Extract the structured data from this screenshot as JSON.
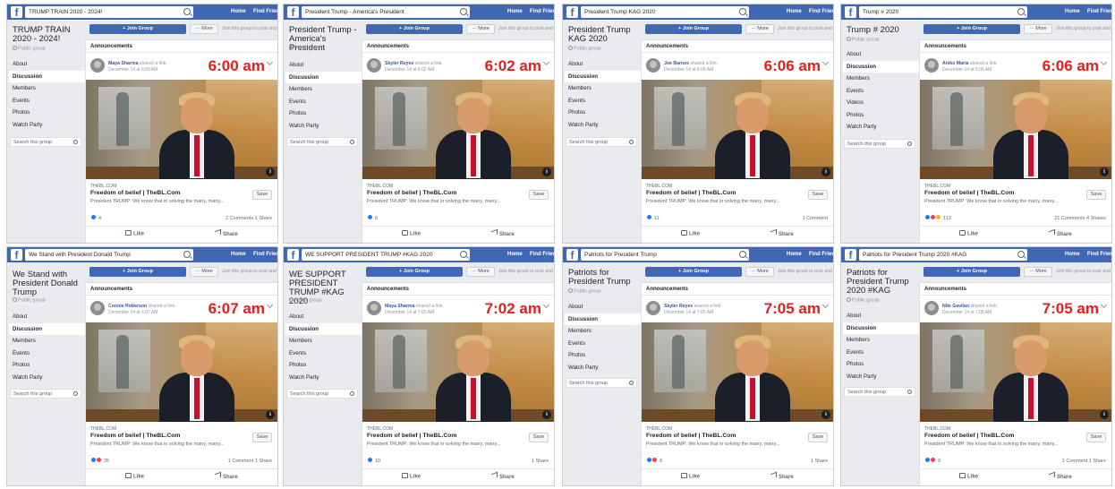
{
  "common": {
    "home": "Home",
    "find_friends": "Find Friends",
    "join_group": "+ Join Group",
    "more": "··· More",
    "join_hint": "Join this group to post and",
    "announcements": "Announcements",
    "public_group": "Public group",
    "shared_link": "shared a link.",
    "site": "THEBL.COM",
    "link_title": "Freedom of belief | TheBL.Com",
    "link_desc": "President TRUMP: We know that in solving the many, many...",
    "save": "Save",
    "like": "Like",
    "share": "Share",
    "search_group": "Search this group",
    "fb_letter": "f",
    "info_letter": "i",
    "menu_labels": {
      "about": "About",
      "discussion": "Discussion",
      "members": "Members",
      "events": "Events",
      "videos": "Videos",
      "photos": "Photos",
      "watch_party": "Watch Party"
    }
  },
  "colors": {
    "facebook_blue": "#4267b2",
    "time_red": "#e02020",
    "link_blue": "#385898"
  },
  "screenshots": [
    {
      "search_text": "TRUMP TRAIN 2020 - 2024!",
      "group_name": "TRUMP TRAIN 2020 - 2024!",
      "poster": "Maya Sharma",
      "date": "December 14 at 6:00 AM",
      "time": "6:00 am",
      "reaction_count": "4",
      "comments": "2 Comments  1 Share"
    },
    {
      "search_text": "President Trump - America's President",
      "group_name": "President Trump - America's President",
      "poster": "Skyler Reyes",
      "date": "December 14 at 6:02 AM",
      "time": "6:02 am",
      "reaction_count": "8",
      "comments": ""
    },
    {
      "search_text": "President Trump KAG 2020",
      "group_name": "President Trump KAG 2020",
      "poster": "Joe Barnes",
      "date": "December 14 at 6:06 AM",
      "time": "6:06 am",
      "reaction_count": "11",
      "comments": "1 Comment"
    },
    {
      "search_text": "Trump # 2020",
      "group_name": "Trump # 2020",
      "poster": "Aniko Maria",
      "date": "December 14 at 6:06 AM",
      "time": "6:06 am",
      "reaction_count": "113",
      "comments": "21 Comments  4 Shares"
    },
    {
      "search_text": "We Stand with President Donald Trump",
      "group_name": "We Stand with President Donald Trump",
      "poster": "Connie Roberson",
      "date": "December 14 at 6:07 AM",
      "time": "6:07 am",
      "reaction_count": "35",
      "comments": "1 Comment  1 Share"
    },
    {
      "search_text": "WE SUPPORT PRESIDENT TRUMP #KAG 2020",
      "group_name": "WE SUPPORT PRESIDENT TRUMP #KAG 2020",
      "poster": "Maya Sharma",
      "date": "December 14 at 7:02 AM",
      "time": "7:02 am",
      "reaction_count": "10",
      "comments": "1 Share"
    },
    {
      "search_text": "Patriots for President Trump",
      "group_name": "Patriots for President Trump",
      "poster": "Skyler Reyes",
      "date": "December 14 at 7:05 AM",
      "time": "7:05 am",
      "reaction_count": "6",
      "comments": "1 Share"
    },
    {
      "search_text": "Patriots for President Trump 2020 #KAG",
      "group_name": "Patriots for President Trump 2020 #KAG",
      "poster": "Nite Gavilan",
      "date": "December 14 at 7:05 AM",
      "time": "7:05 am",
      "reaction_count": "9",
      "comments": "1 Comment  1 Share"
    }
  ]
}
